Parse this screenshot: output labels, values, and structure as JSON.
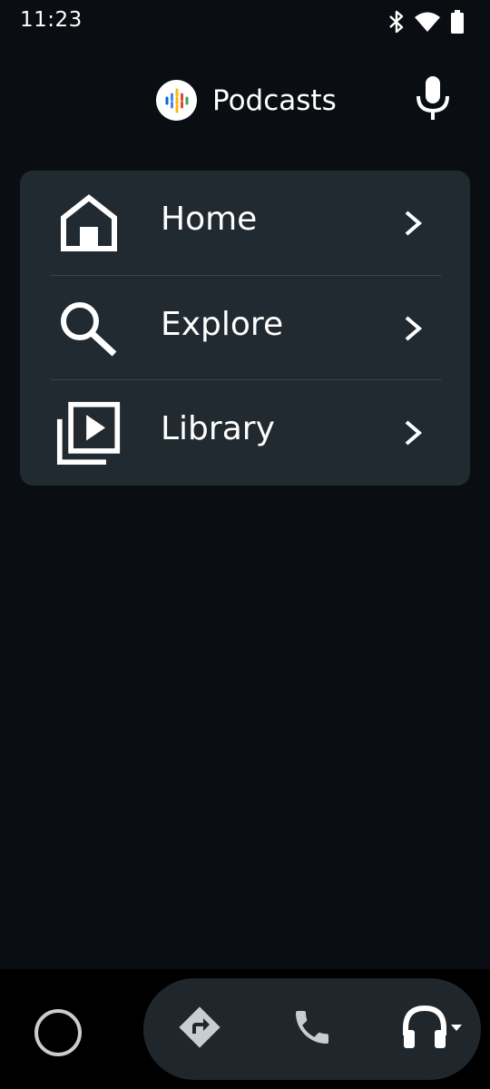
{
  "status_bar": {
    "time": "11:23",
    "icons": [
      "bluetooth-icon",
      "wifi-icon",
      "battery-icon"
    ]
  },
  "header": {
    "app_title": "Podcasts",
    "logo_icon": "google-podcasts-logo",
    "mic_icon": "microphone-icon"
  },
  "menu": {
    "items": [
      {
        "label": "Home",
        "icon": "home-icon"
      },
      {
        "label": "Explore",
        "icon": "search-icon"
      },
      {
        "label": "Library",
        "icon": "library-icon"
      }
    ],
    "chevron_icon": "chevron-right-icon"
  },
  "bottom_nav": {
    "items": [
      "home-circle-icon",
      "navigation-icon",
      "phone-icon",
      "headphones-icon"
    ]
  },
  "colors": {
    "background": "#0a0e12",
    "card": "#212a30",
    "divider": "#3a444b",
    "nav_pill": "#1f272d",
    "icon_gray": "#c9cdd0",
    "text": "#ffffff"
  }
}
